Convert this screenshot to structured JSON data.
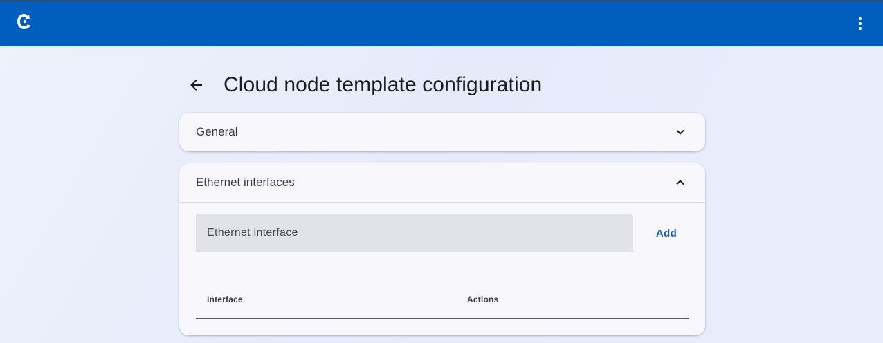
{
  "appbar": {
    "logo_icon": "app-logo-icon",
    "menu_icon": "more-vert-icon",
    "background_color": "#005fbe"
  },
  "page": {
    "back_icon": "arrow-back-icon",
    "title": "Cloud node template configuration"
  },
  "panels": {
    "general": {
      "title": "General",
      "expanded": false,
      "icon": "chevron-down-icon"
    },
    "ethernet": {
      "title": "Ethernet interfaces",
      "expanded": true,
      "icon": "chevron-up-icon",
      "input": {
        "placeholder": "Ethernet interface",
        "value": ""
      },
      "add_label": "Add",
      "table": {
        "columns": [
          "Interface",
          "Actions"
        ],
        "rows": []
      }
    }
  },
  "colors": {
    "accent": "#1f5fa8",
    "title_text": "#1b1c20"
  }
}
